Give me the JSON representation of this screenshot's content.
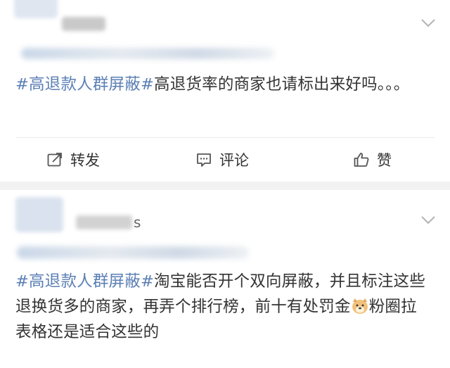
{
  "posts": [
    {
      "username_tail": "",
      "hashtag": "#高退款人群屏蔽#",
      "text": "高退货率的商家也请标出来好吗。。。",
      "actions": {
        "repost_label": "转发",
        "comment_label": "评论",
        "like_label": "赞"
      }
    },
    {
      "username_tail": "s",
      "hashtag": "#高退款人群屏蔽#",
      "text_part1": "淘宝能否开个双向屏蔽，并且标注这些退换货多的商家，再弄个排行榜，前十有处罚金",
      "emoji_name": "doge-emoji",
      "text_part2": "粉圈拉表格还是适合这些的"
    }
  ],
  "colors": {
    "hashtag": "#5b7fb5",
    "text": "#333333",
    "separator": "#f2f2f2"
  }
}
